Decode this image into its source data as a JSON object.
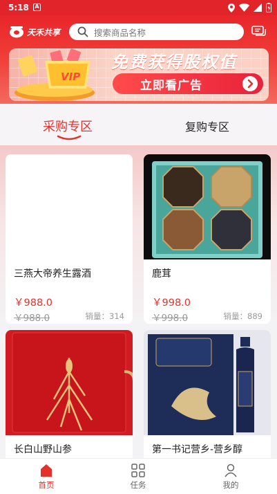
{
  "status_bar": {
    "time": "5:18",
    "a_badge": "A"
  },
  "header": {
    "logo_text": "天禾共享",
    "search_placeholder": "搜索商品名称"
  },
  "banner": {
    "headline": "免费获得股权值",
    "cta_label": "立即看广告",
    "vip_label": "VIP"
  },
  "tabs": [
    {
      "label": "采购专区",
      "active": true
    },
    {
      "label": "复购专区",
      "active": false
    }
  ],
  "products": [
    {
      "name": "三燕大帝养生露酒",
      "price": "￥988.0",
      "original_price": "￥988.0",
      "sales": "销量：314"
    },
    {
      "name": "鹿茸",
      "price": "￥998.0",
      "original_price": "￥998.0",
      "sales": "销量：889"
    },
    {
      "name": "长白山野山参"
    },
    {
      "name": "第一书记营乡-营乡醇"
    }
  ],
  "bottom_nav": [
    {
      "label": "首页",
      "active": true
    },
    {
      "label": "任务",
      "active": false
    },
    {
      "label": "我的",
      "active": false
    }
  ],
  "colors": {
    "brand_red": "#e3322c",
    "header_red": "#e8262b"
  }
}
